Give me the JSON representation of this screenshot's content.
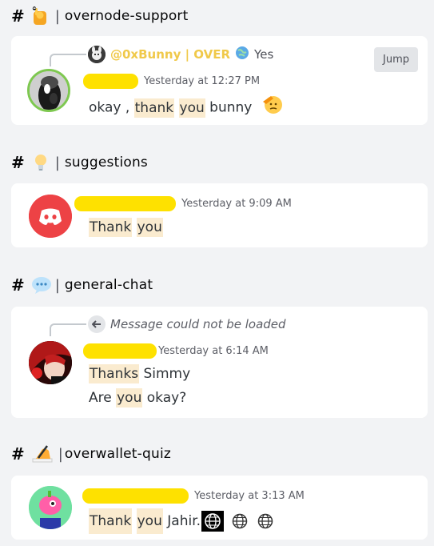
{
  "channels": [
    {
      "name": "overnode-support",
      "hash": "#",
      "sep": "|"
    },
    {
      "name": "suggestions",
      "hash": "#",
      "sep": "|"
    },
    {
      "name": "general-chat",
      "hash": "#",
      "sep": "|"
    },
    {
      "name": "overwallet-quiz",
      "hash": "#",
      "sep": "|"
    }
  ],
  "messages": [
    {
      "reply_author": "@0xBunny | OVER",
      "reply_text": "Yes",
      "jump_label": "Jump",
      "time": "Yesterday at 12:27 PM",
      "text_parts": [
        "okay , ",
        "thank",
        " ",
        "you",
        " bunny"
      ]
    },
    {
      "time": "Yesterday at 9:09 AM",
      "text_parts": [
        "Thank",
        " ",
        "you"
      ]
    },
    {
      "reply_text": "Message could not be loaded",
      "time": "Yesterday at 6:14 AM",
      "line1_parts": [
        "Thanks",
        " Simmy"
      ],
      "line2_parts": [
        "Are ",
        "you",
        " okay?"
      ]
    },
    {
      "time": "Yesterday at 3:13 AM",
      "text_parts": [
        "Thank",
        " ",
        "you",
        " Jahir."
      ]
    }
  ],
  "colors": {
    "background": "#f2f3f5",
    "card": "#ffffff",
    "redaction": "#fee100",
    "highlight": "#faebcf",
    "reply_author": "#f0c94a",
    "discord_red": "#ed4245"
  }
}
